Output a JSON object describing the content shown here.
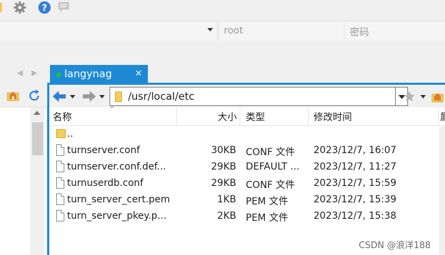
{
  "toolbar": {
    "icons": [
      "gear-icon",
      "help-icon",
      "message-icon"
    ]
  },
  "login": {
    "user": "root",
    "password_placeholder": "密码"
  },
  "tab": {
    "label": "langynag",
    "close": "×",
    "status_color": "#22c33b",
    "accent": "#1e8ad6"
  },
  "pathbar": {
    "path": "/usr/local/etc"
  },
  "columns": {
    "name": "名称",
    "size": "大小",
    "type": "类型",
    "mtime": "修改时间",
    "perm": "属"
  },
  "rows": [
    {
      "name": "..",
      "size": "",
      "type": "",
      "mtime": "",
      "icon": "folder-icon"
    },
    {
      "name": "turnserver.conf",
      "size": "30KB",
      "type": "CONF 文件",
      "mtime": "2023/12/7, 16:07",
      "icon": "file-icon"
    },
    {
      "name": "turnserver.conf.def...",
      "size": "29KB",
      "type": "DEFAULT ...",
      "mtime": "2023/12/7, 11:27",
      "icon": "file-icon"
    },
    {
      "name": "turnuserdb.conf",
      "size": "29KB",
      "type": "CONF 文件",
      "mtime": "2023/12/7, 15:59",
      "icon": "file-icon"
    },
    {
      "name": "turn_server_cert.pem",
      "size": "1KB",
      "type": "PEM 文件",
      "mtime": "2023/12/7, 15:39",
      "icon": "file-icon"
    },
    {
      "name": "turn_server_pkey.p...",
      "size": "2KB",
      "type": "PEM 文件",
      "mtime": "2023/12/7, 15:38",
      "icon": "file-icon"
    }
  ],
  "watermark": "CSDN @浪洋188"
}
